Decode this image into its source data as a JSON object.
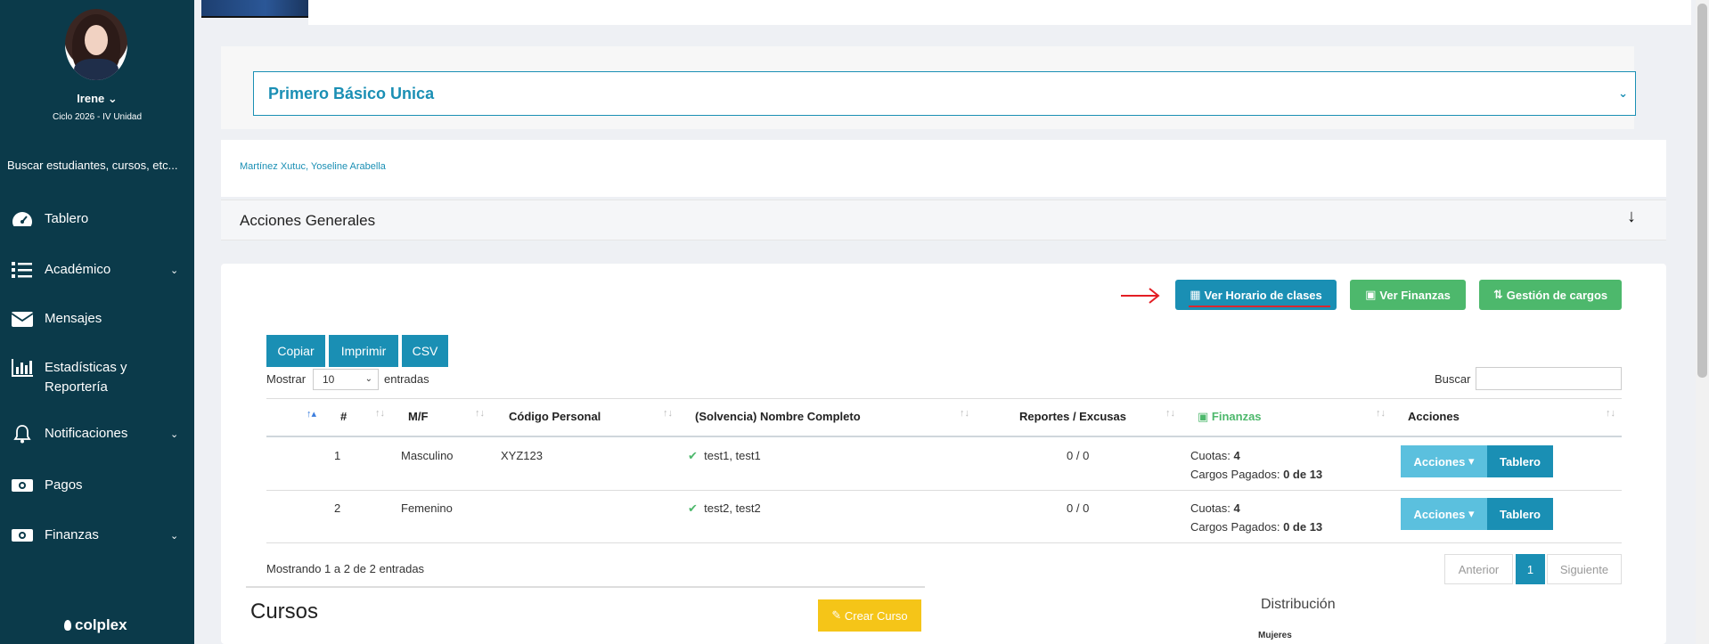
{
  "sidebar": {
    "user_name": "Irene",
    "cycle": "Ciclo 2026 - IV Unidad",
    "search_text": "Buscar estudiantes, cursos, etc...",
    "items": [
      {
        "label": "Tablero",
        "icon": "dashboard-icon",
        "has_chevron": false
      },
      {
        "label": "Académico",
        "icon": "list-icon",
        "has_chevron": true
      },
      {
        "label": "Mensajes",
        "icon": "envelope-icon",
        "has_chevron": false
      },
      {
        "label": "Estadísticas y",
        "label2": "Reportería",
        "icon": "bar-chart-icon",
        "has_chevron": false
      },
      {
        "label": "Notificaciones",
        "icon": "bell-icon",
        "has_chevron": true
      },
      {
        "label": "Pagos",
        "icon": "money-icon",
        "has_chevron": false
      },
      {
        "label": "Finanzas",
        "icon": "money-icon",
        "has_chevron": true
      }
    ],
    "brand": "colplex"
  },
  "course_select": {
    "value": "Primero Básico Unica"
  },
  "names": "Martínez Xutuc, Yoseline Arabella",
  "general_actions": {
    "title": "Acciones Generales"
  },
  "toolbar": {
    "schedule_label": "Ver Horario de clases",
    "finance_label": "Ver Finanzas",
    "charges_label": "Gestión de cargos"
  },
  "datatable": {
    "copy_label": "Copiar",
    "print_label": "Imprimir",
    "csv_label": "CSV",
    "show_label": "Mostrar",
    "page_size": "10",
    "entries_label": "entradas",
    "search_label": "Buscar",
    "columns": [
      "#",
      "M/F",
      "Código Personal",
      "(Solvencia) Nombre Completo",
      "Reportes / Excusas",
      "Finanzas",
      "Acciones"
    ],
    "rows": [
      {
        "num": "1",
        "gender": "Masculino",
        "code": "XYZ123",
        "name": "test1, test1",
        "reports": "0 / 0",
        "cuotas_label": "Cuotas:",
        "cuotas": "4",
        "paid_label": "Cargos Pagados:",
        "paid": "0 de 13"
      },
      {
        "num": "2",
        "gender": "Femenino",
        "code": "",
        "name": "test2, test2",
        "reports": "0 / 0",
        "cuotas_label": "Cuotas:",
        "cuotas": "4",
        "paid_label": "Cargos Pagados:",
        "paid": "0 de 13"
      }
    ],
    "actions_label": "Acciones",
    "dashboard_label": "Tablero",
    "showing": "Mostrando 1 a 2 de 2 entradas",
    "prev": "Anterior",
    "page": "1",
    "next": "Siguiente"
  },
  "cursos": {
    "title": "Cursos",
    "create_label": "Crear Curso"
  },
  "distribution": {
    "title": "Distribución",
    "mujeres": "Mujeres"
  },
  "colors": {
    "sidebar_bg": "#0b3a4a",
    "primary": "#1a8fb4",
    "success": "#4db86c",
    "warning": "#f5c518",
    "info": "#5bc0de"
  }
}
